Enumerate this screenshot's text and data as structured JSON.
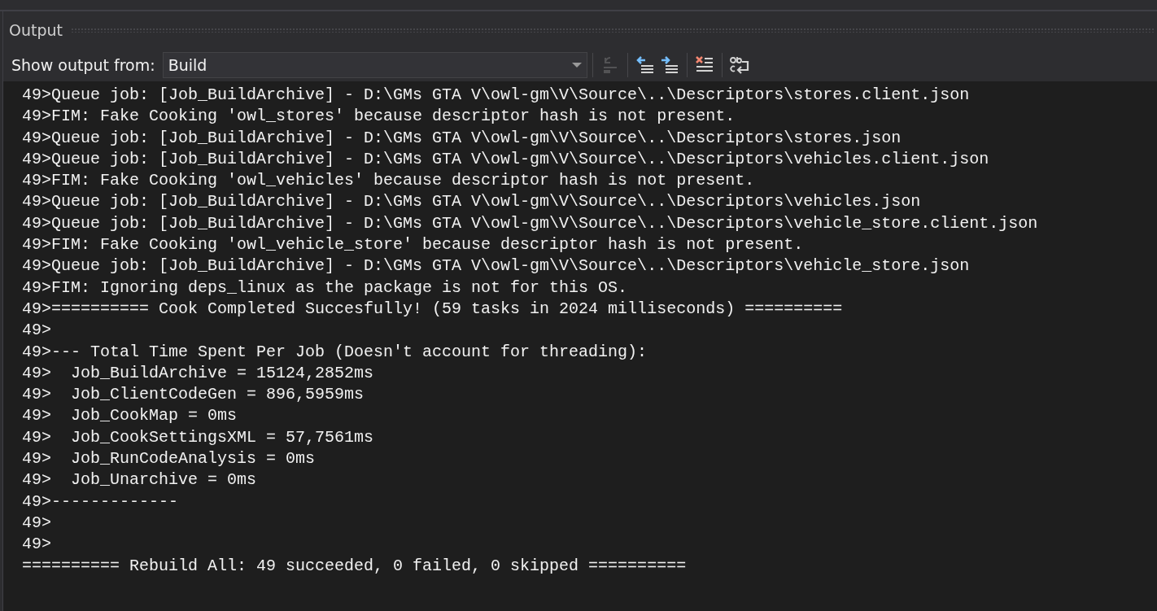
{
  "panel": {
    "title": "Output"
  },
  "toolbar": {
    "source_label": "Show output from:",
    "source_value": "Build",
    "buttons": [
      {
        "kind": "goto",
        "disabled": true
      },
      {
        "kind": "prev",
        "disabled": false
      },
      {
        "kind": "next",
        "disabled": false
      },
      {
        "kind": "clear",
        "disabled": false
      },
      {
        "kind": "wrap",
        "disabled": false
      }
    ]
  },
  "lines": [
    "49>Queue job: [Job_BuildArchive] - D:\\GMs GTA V\\owl-gm\\V\\Source\\..\\Descriptors\\stores.client.json",
    "49>FIM: Fake Cooking 'owl_stores' because descriptor hash is not present.",
    "49>Queue job: [Job_BuildArchive] - D:\\GMs GTA V\\owl-gm\\V\\Source\\..\\Descriptors\\stores.json",
    "49>Queue job: [Job_BuildArchive] - D:\\GMs GTA V\\owl-gm\\V\\Source\\..\\Descriptors\\vehicles.client.json",
    "49>FIM: Fake Cooking 'owl_vehicles' because descriptor hash is not present.",
    "49>Queue job: [Job_BuildArchive] - D:\\GMs GTA V\\owl-gm\\V\\Source\\..\\Descriptors\\vehicles.json",
    "49>Queue job: [Job_BuildArchive] - D:\\GMs GTA V\\owl-gm\\V\\Source\\..\\Descriptors\\vehicle_store.client.json",
    "49>FIM: Fake Cooking 'owl_vehicle_store' because descriptor hash is not present.",
    "49>Queue job: [Job_BuildArchive] - D:\\GMs GTA V\\owl-gm\\V\\Source\\..\\Descriptors\\vehicle_store.json",
    "49>FIM: Ignoring deps_linux as the package is not for this OS.",
    "49>========== Cook Completed Succesfully! (59 tasks in 2024 milliseconds) ==========",
    "49>",
    "49>--- Total Time Spent Per Job (Doesn't account for threading):",
    "49>  Job_BuildArchive = 15124,2852ms",
    "49>  Job_ClientCodeGen = 896,5959ms",
    "49>  Job_CookMap = 0ms",
    "49>  Job_CookSettingsXML = 57,7561ms",
    "49>  Job_RunCodeAnalysis = 0ms",
    "49>  Job_Unarchive = 0ms",
    "49>-------------",
    "49>",
    "49>",
    "========== Rebuild All: 49 succeeded, 0 failed, 0 skipped =========="
  ]
}
